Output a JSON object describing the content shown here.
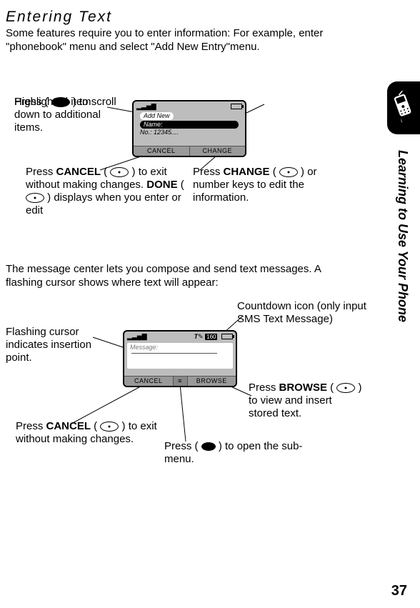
{
  "heading": "Entering Text",
  "intro": "Some features require you to enter information: For example, enter \"phonebook\" menu and select \"Add New Entry\"menu.",
  "paragraph2": "The message center lets you compose and send text messages. A flashing cursor shows where text will appear:",
  "sidebar_text": "Learning to Use Your Phone",
  "page_number": "37",
  "screen1": {
    "add_new": "Add New",
    "name_label": "Name:",
    "no_label": "No.: 12345....",
    "softkey_left": "CANCEL",
    "softkey_right": "CHANGE"
  },
  "screen2": {
    "msg_label": "Message:",
    "counter": "160",
    "t_icon": "T",
    "softkey_left": "CANCEL",
    "softkey_right": "BROWSE"
  },
  "callouts1": {
    "scroll_a": "Press ( ",
    "scroll_b": " ) to scroll down to additional items.",
    "highlight": "Highlighted item",
    "cancel_a": "Press ",
    "cancel_label": "CANCEL",
    "cancel_b": " ( ",
    "cancel_c": " ) to exit without making changes. ",
    "done_label": "DONE",
    "done_b": " ( ",
    "done_c": " ) displays when you enter or edit",
    "change_a": "Press ",
    "change_label": "CHANGE",
    "change_b": " ( ",
    "change_c": " ) or number keys to edit the information."
  },
  "callouts2": {
    "cursor": "Flashing cursor indicates insertion point.",
    "countdown": "Countdown icon (only input SMS Text Message)",
    "browse_a": "Press ",
    "browse_label": "BROWSE",
    "browse_b": " ( ",
    "browse_c": " ) to view and insert stored text.",
    "cancel_a": "Press ",
    "cancel_label": "CANCEL",
    "cancel_b": " ( ",
    "cancel_c": " ) to exit without making changes.",
    "submenu_a": "Press ( ",
    "submenu_b": " ) to open the sub-menu."
  }
}
